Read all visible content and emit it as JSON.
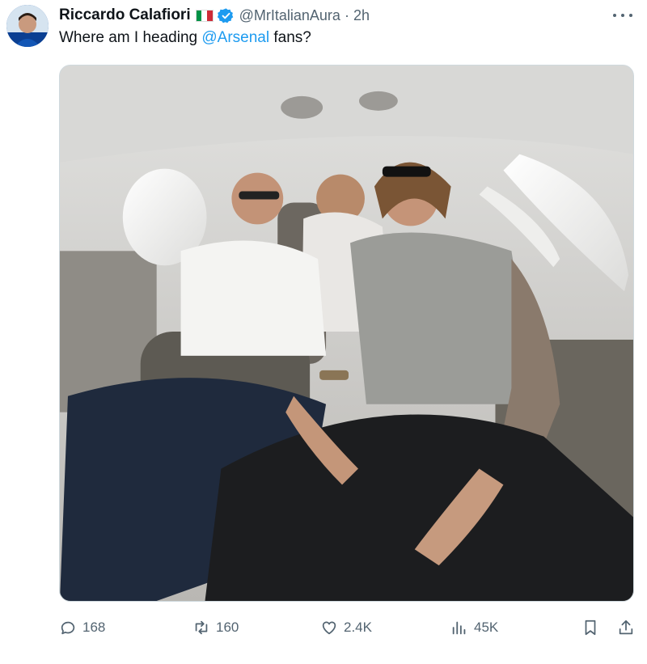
{
  "author": {
    "display_name": "Riccardo Calafiori",
    "handle": "@MrItalianAura",
    "separator": "·",
    "time": "2h"
  },
  "tweet": {
    "text_before": "Where am I heading ",
    "mention": "@Arsenal",
    "text_after": " fans?"
  },
  "media": {
    "description_icons": [
      "photo"
    ]
  },
  "actions": {
    "replies": "168",
    "reposts": "160",
    "likes": "2.4K",
    "views": "45K"
  },
  "colors": {
    "accent": "#1d9bf0",
    "secondary_text": "#536471",
    "flag": [
      "#009246",
      "#ffffff",
      "#ce2b37"
    ]
  },
  "icons": [
    "avatar",
    "flag-italy-icon",
    "verified-badge-icon",
    "more-icon",
    "reply-icon",
    "repost-icon",
    "like-icon",
    "views-icon",
    "bookmark-icon",
    "share-icon"
  ]
}
